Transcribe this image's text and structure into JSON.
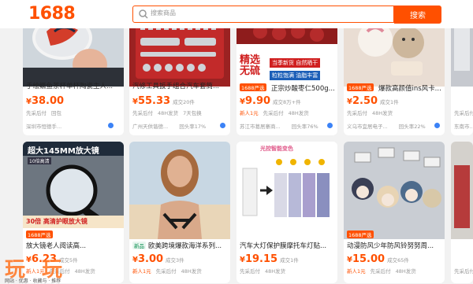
{
  "header": {
    "logo": "1688",
    "search_placeholder": "搜索商品",
    "search_button": "搜索"
  },
  "row1": [
    {
      "title": "手绘鳜鱼茶杯单杯陶瓷主人...",
      "price_sym": "¥",
      "price": "38.00",
      "sold": "",
      "tags": [
        "先采后付",
        "回包"
      ],
      "store": "深圳市恒德手...",
      "repeat": ""
    },
    {
      "title": "汽修工具扳手组合汽车套筒...",
      "price_sym": "¥",
      "price": "55.33",
      "sold": "成交20件",
      "tags": [
        "先采后付",
        "48H发货",
        "7天包换"
      ],
      "store": "广州天供谐德...",
      "repeat": "回头率17%"
    },
    {
      "title": "正宗炒酸枣仁500g...",
      "price_sym": "¥",
      "price": "9.90",
      "sold": "成交8万+件",
      "badge": "1688严选",
      "tags": [
        "新人1元",
        "先采后付",
        "48H发货"
      ],
      "store": "苏江市葛居寨商...",
      "repeat": "回头率76%"
    },
    {
      "title": "爆款高颜值ins风卡...",
      "price_sym": "¥",
      "price": "2.50",
      "sold": "成交1件",
      "badge": "1688严选",
      "tags": [
        "先采后付",
        "48H发货"
      ],
      "store": "义乌市宜居电子...",
      "repeat": "回头率22%"
    },
    {
      "title": "...",
      "price_sym": "¥",
      "price": "",
      "sold": "",
      "tags": [
        "先采后付"
      ],
      "store": "东南市...",
      "repeat": ""
    }
  ],
  "row1_images": {
    "p3_banner_top": "精选",
    "p3_banner_mid": "无硫",
    "p3_red_tag": "当季新货 自然晒干",
    "p3_blue_tag": "粒粒饱满 油脂丰富"
  },
  "row2": [
    {
      "title": "放大镜老人阅读高...",
      "price_sym": "¥",
      "price": "6.23",
      "sold": "成交5件",
      "badge": "1688严选",
      "tags": [
        "新人1元",
        "先采后付",
        "48H发货"
      ],
      "img_top": "超大145MM放大镜",
      "img_sub": "10倍高清",
      "img_bottom": "30倍 高清护眼放大镜"
    },
    {
      "title": "欧美跨境爆款海洋系列...",
      "price_sym": "¥",
      "price": "3.00",
      "sold": "成交3件",
      "new": "新品",
      "tags": [
        "新人1元",
        "先采后付",
        "48H发货"
      ]
    },
    {
      "title": "汽车大灯保护膜摩托车灯贴...",
      "price_sym": "¥",
      "price": "19.15",
      "sold": "成交1件",
      "tags": [
        "先采后付",
        "48H发货"
      ],
      "img_top": "光控智能变色"
    },
    {
      "title": "动漫防风少年防风铃努努周...",
      "price_sym": "¥",
      "price": "15.00",
      "sold": "成交65件",
      "badge": "1688严选",
      "tags": [
        "新人1元",
        "先采后付",
        "48H发货"
      ]
    },
    {
      "title": "...",
      "price_sym": "¥",
      "price": "",
      "sold": "",
      "tags": [
        "先采后付"
      ]
    }
  ],
  "watermark": "玩 玩",
  "watermark_sub": "网站 · 优惠 · 收藏与 · 推荐"
}
